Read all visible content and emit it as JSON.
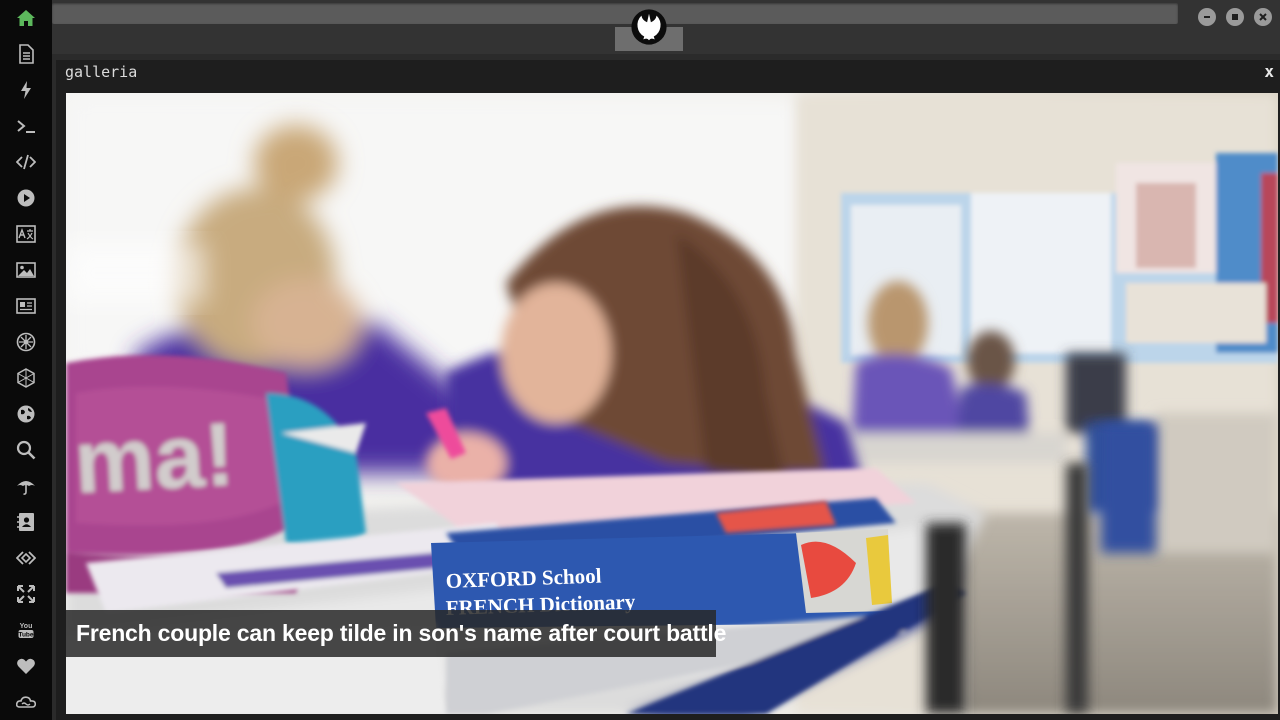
{
  "sidebar": {
    "items": [
      {
        "icon": "home-icon",
        "color": "#5cb85c"
      },
      {
        "icon": "document-icon"
      },
      {
        "icon": "lightning-icon"
      },
      {
        "icon": "terminal-icon"
      },
      {
        "icon": "code-icon"
      },
      {
        "icon": "play-icon"
      },
      {
        "icon": "translate-icon"
      },
      {
        "icon": "image-icon"
      },
      {
        "icon": "newspaper-icon"
      },
      {
        "icon": "settings-wheel-icon"
      },
      {
        "icon": "cube-icon"
      },
      {
        "icon": "globe-icon"
      },
      {
        "icon": "search-icon"
      },
      {
        "icon": "umbrella-icon"
      },
      {
        "icon": "contact-card-icon"
      },
      {
        "icon": "diamond-code-icon"
      },
      {
        "icon": "expand-icon"
      },
      {
        "icon": "youtube-icon"
      },
      {
        "icon": "heart-icon"
      },
      {
        "icon": "cloud-icon"
      }
    ]
  },
  "topbar": {
    "logo_icon": "rebel-alliance-icon",
    "window_controls": [
      "minimize-icon",
      "maximize-icon",
      "close-icon"
    ]
  },
  "gallery": {
    "title": "galleria",
    "close_label": "x",
    "caption": "French couple can keep tilde in son's name after court battle",
    "book_title_line1": "OXFORD School",
    "book_title_line2": "FRENCH Dictionary"
  },
  "colors": {
    "rail_bg": "#0a0a0a",
    "accent_green": "#5cb85c",
    "icon_gray": "#bdbdbd"
  }
}
